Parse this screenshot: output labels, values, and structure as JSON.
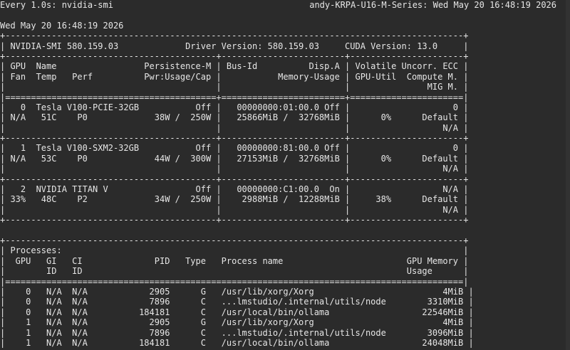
{
  "watch": {
    "command": "Every 1.0s: nvidia-smi",
    "host_time": "andy-KRPA-U16-M-Series: Wed May 20 16:48:19 2026"
  },
  "lines": [
    "Wed May 20 16:48:19 2026",
    "+-----------------------------------------------------------------------------------------+",
    "| NVIDIA-SMI 580.159.03             Driver Version: 580.159.03     CUDA Version: 13.0     |",
    "+-----------------------------------------+------------------------+----------------------+",
    "| GPU  Name                 Persistence-M | Bus-Id          Disp.A | Volatile Uncorr. ECC |",
    "| Fan  Temp   Perf          Pwr:Usage/Cap |           Memory-Usage | GPU-Util  Compute M. |",
    "|                                         |                        |               MIG M. |",
    "|=========================================+========================+======================|",
    "|   0  Tesla V100-PCIE-32GB           Off |   00000000:01:00.0 Off |                    0 |",
    "| N/A   51C    P0             38W /  250W |   25866MiB /  32768MiB |      0%      Default |",
    "|                                         |                        |                  N/A |",
    "+-----------------------------------------+------------------------+----------------------+",
    "|   1  Tesla V100-SXM2-32GB           Off |   00000000:81:00.0 Off |                    0 |",
    "| N/A   53C    P0             44W /  300W |   27153MiB /  32768MiB |      0%      Default |",
    "|                                         |                        |                  N/A |",
    "+-----------------------------------------+------------------------+----------------------+",
    "|   2  NVIDIA TITAN V                 Off |   00000000:C1:00.0  On |                  N/A |",
    "| 33%   48C    P2             34W /  250W |    2988MiB /  12288MiB |     38%      Default |",
    "|                                         |                        |                  N/A |",
    "+-----------------------------------------+------------------------+----------------------+",
    "",
    "+-----------------------------------------------------------------------------------------+",
    "| Processes:                                                                              |",
    "|  GPU   GI   CI              PID   Type   Process name                        GPU Memory |",
    "|        ID   ID                                                               Usage      |",
    "|=========================================================================================|",
    "|    0   N/A  N/A            2905      G   /usr/lib/xorg/Xorg                         4MiB |",
    "|    0   N/A  N/A            7896      C   ...lmstudio/.internal/utils/node        3310MiB |",
    "|    0   N/A  N/A          184181      C   /usr/local/bin/ollama                  22546MiB |",
    "|    1   N/A  N/A            2905      G   /usr/lib/xorg/Xorg                         4MiB |",
    "|    1   N/A  N/A            7896      C   ...lmstudio/.internal/utils/node        3096MiB |",
    "|    1   N/A  N/A          184181      C   /usr/local/bin/ollama                  24048MiB |"
  ]
}
